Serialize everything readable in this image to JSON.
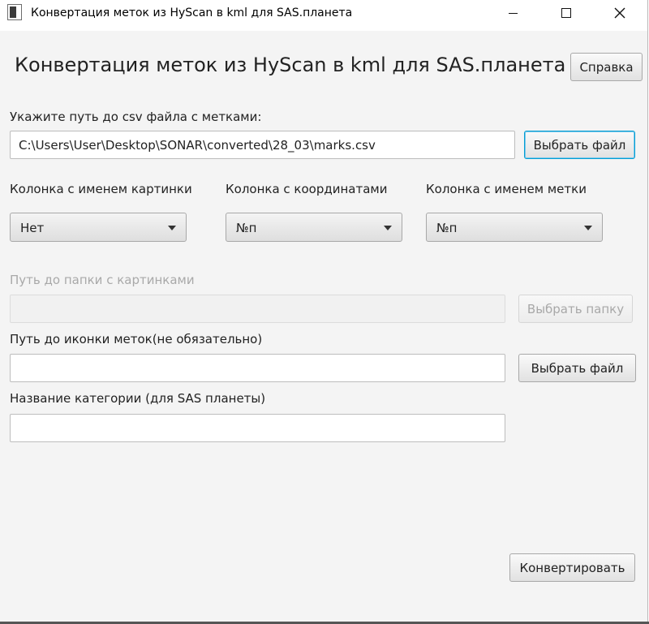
{
  "window": {
    "title": "Конвертация меток из HyScan в kml для SAS.планета",
    "icon": "app-icon"
  },
  "header": {
    "title": "Конвертация меток из HyScan в kml для SAS.планета",
    "help_label": "Справка"
  },
  "csv": {
    "label": "Укажите путь до csv файла с метками:",
    "value": "C:\\Users\\User\\Desktop\\SONAR\\converted\\28_03\\marks.csv",
    "choose_label": "Выбрать файл"
  },
  "columns": {
    "picture_label": "Колонка с именем картинки",
    "picture_value": "Нет",
    "coords_label": "Колонка с координатами",
    "coords_value": "№п",
    "name_label": "Колонка с именем метки",
    "name_value": "№п"
  },
  "pictures_folder": {
    "label": "Путь до папки с картинками",
    "value": "",
    "choose_label": "Выбрать папку"
  },
  "icon": {
    "label": "Путь до иконки меток(не обязательно)",
    "value": "",
    "choose_label": "Выбрать файл"
  },
  "category": {
    "label": "Название категории (для SAS планеты)",
    "value": ""
  },
  "convert_label": "Конвертировать",
  "colors": {
    "background": "#f4f4f4",
    "focus_border": "#039ed3",
    "disabled_text": "#a9a9a9"
  }
}
